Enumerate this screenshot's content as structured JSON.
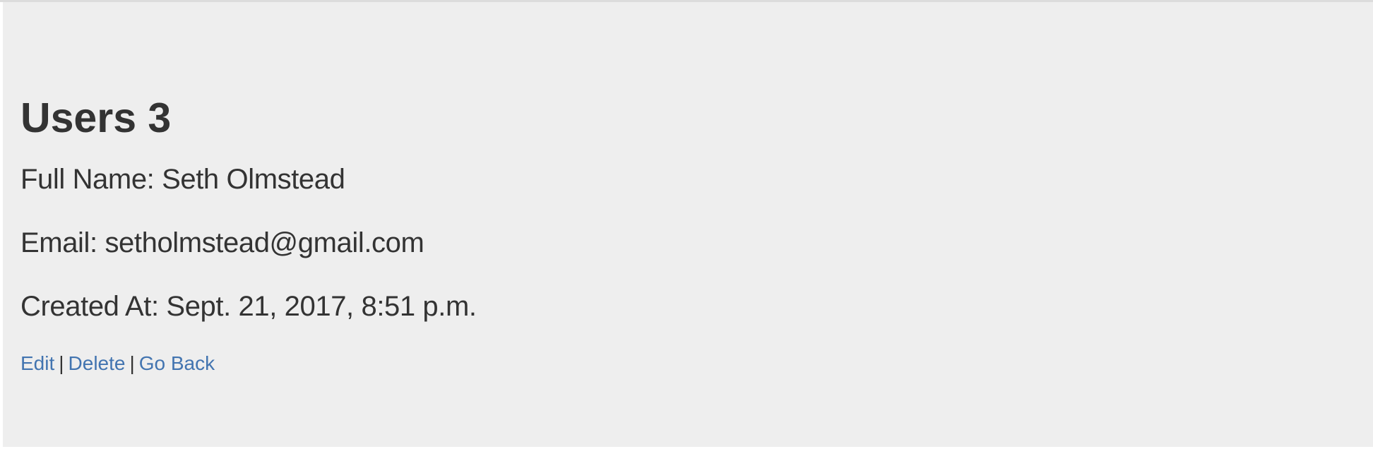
{
  "page": {
    "title": "Users 3"
  },
  "user": {
    "full_name_line": "Full Name: Seth Olmstead",
    "email_line": "Email: setholmstead@gmail.com",
    "created_at_line": "Created At: Sept. 21, 2017, 8:51 p.m."
  },
  "actions": {
    "edit_label": "Edit",
    "delete_label": "Delete",
    "back_label": "Go Back",
    "separator": "|"
  },
  "colors": {
    "background": "#eeeeee",
    "text": "#333333",
    "link": "#4274b0"
  }
}
